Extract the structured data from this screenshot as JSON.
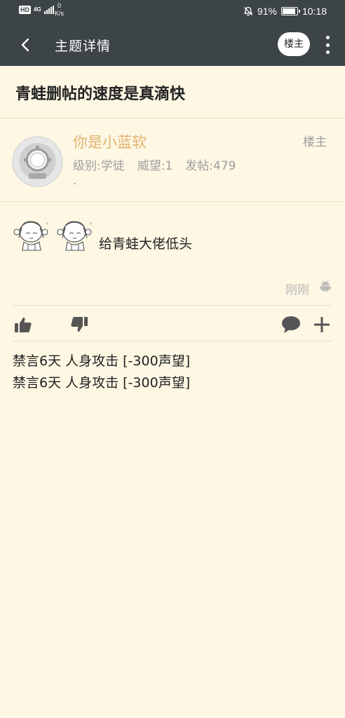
{
  "status_bar": {
    "hd": "HD",
    "network": "4G",
    "speed_value": "0",
    "speed_unit": "K/s",
    "battery": "91%",
    "battery_level": 0.91,
    "time": "10:18"
  },
  "app_bar": {
    "title": "主题详情",
    "louzhu_button": "楼主"
  },
  "topic": {
    "title": "青蛙删帖的速度是真滴快"
  },
  "author": {
    "name": "你是小蓝软",
    "badge": "楼主",
    "level": "级别:学徒",
    "reputation": "威望:1",
    "posts": "发帖:479",
    "signature": "-"
  },
  "post": {
    "text": "给青蛙大佬低头",
    "time": "刚刚",
    "device_icon": "android-icon"
  },
  "actions": {
    "icons": [
      "thumb-up-icon",
      "thumb-down-icon",
      "comment-icon",
      "add-icon"
    ]
  },
  "penalties": [
    "禁言6天 人身攻击 [-300声望]",
    "禁言6天 人身攻击 [-300声望]"
  ],
  "colors": {
    "bar": "#3c4446",
    "background": "#fdf7e3",
    "author_name": "#e3b46f",
    "muted": "#9e9e9e",
    "icon": "#555555"
  }
}
